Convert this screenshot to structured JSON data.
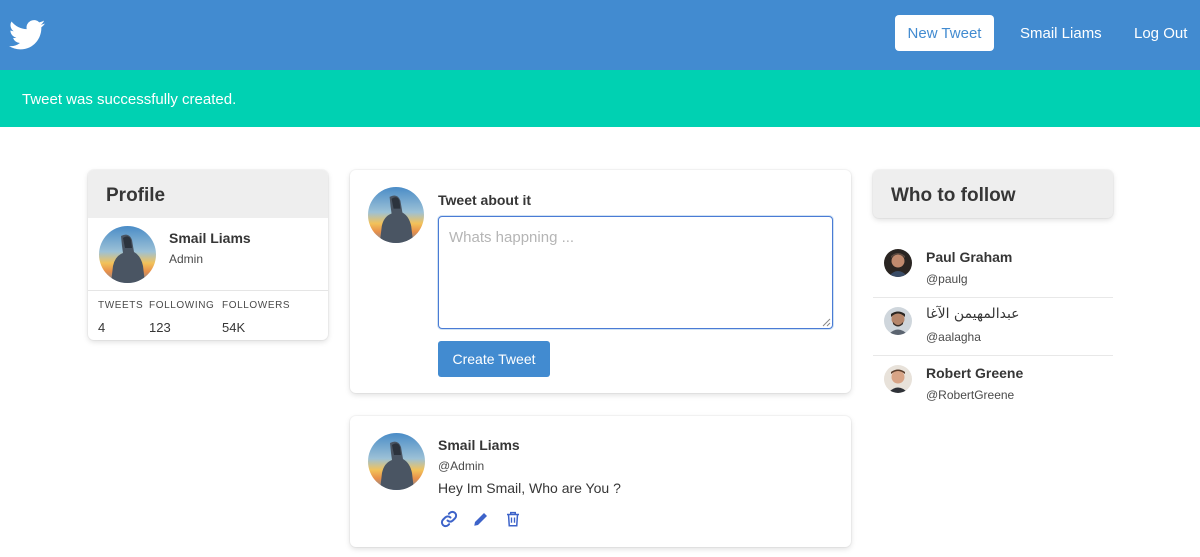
{
  "navbar": {
    "brand_icon": "twitter-bird-icon",
    "new_tweet_label": "New Tweet",
    "user_label": "Smail Liams",
    "logout_label": "Log Out",
    "bg_color": "#428bd0"
  },
  "notification": {
    "message": "Tweet was successfully created.",
    "color": "#00d1b2"
  },
  "profile": {
    "title": "Profile",
    "name": "Smail Liams",
    "role": "Admin",
    "stats": [
      {
        "label": "TWEETS",
        "value": "4"
      },
      {
        "label": "FOLLOWING",
        "value": "123"
      },
      {
        "label": "FOLLOWERS",
        "value": "54K"
      }
    ]
  },
  "compose": {
    "title": "Tweet about it",
    "placeholder": "Whats happning ...",
    "value": "",
    "button_label": "Create Tweet"
  },
  "tweets": [
    {
      "author": "Smail Liams",
      "handle": "@Admin",
      "text": "Hey Im Smail, Who are You ?",
      "actions": [
        "link-icon",
        "pencil-icon",
        "trash-icon"
      ]
    }
  ],
  "who_to_follow": {
    "title": "Who to follow",
    "people": [
      {
        "name": "Paul Graham",
        "handle": "@paulg"
      },
      {
        "name": "عبدالمهيمن الآغا",
        "handle": "@aalagha"
      },
      {
        "name": "Robert Greene",
        "handle": "@RobertGreene"
      }
    ]
  }
}
